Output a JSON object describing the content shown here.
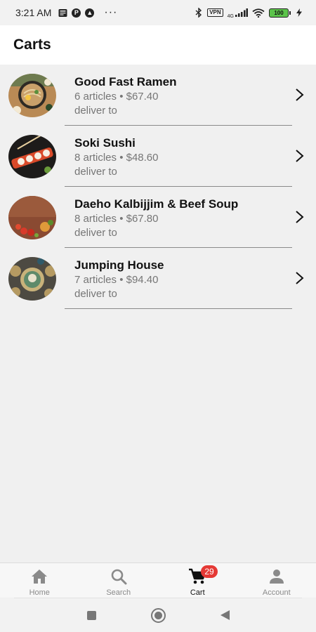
{
  "status_bar": {
    "time": "3:21 AM",
    "vpn": "VPN",
    "network": "4G",
    "battery": "100",
    "icons": [
      "news-icon",
      "app-icon",
      "nav-arrow-icon",
      "more-dots-icon",
      "bluetooth-icon",
      "signal-icon",
      "wifi-icon",
      "battery-icon",
      "charging-icon"
    ]
  },
  "header": {
    "title": "Carts"
  },
  "carts": [
    {
      "name": "Good Fast Ramen",
      "meta": "6 articles • $67.40",
      "sub": "deliver to"
    },
    {
      "name": "Soki Sushi",
      "meta": "8 articles • $48.60",
      "sub": "deliver to"
    },
    {
      "name": "Daeho Kalbijjim & Beef Soup",
      "meta": "8 articles • $67.80",
      "sub": "deliver to"
    },
    {
      "name": "Jumping House",
      "meta": "7 articles • $94.40",
      "sub": "deliver to"
    }
  ],
  "bottom_nav": {
    "items": [
      {
        "label": "Home",
        "icon": "home-icon"
      },
      {
        "label": "Search",
        "icon": "search-icon"
      },
      {
        "label": "Cart",
        "icon": "cart-icon",
        "badge": "29",
        "active": true
      },
      {
        "label": "Account",
        "icon": "account-icon"
      }
    ]
  },
  "colors": {
    "background": "#f0f0f0",
    "badge": "#e53935",
    "battery": "#5cc44b",
    "muted_text": "#767676"
  }
}
